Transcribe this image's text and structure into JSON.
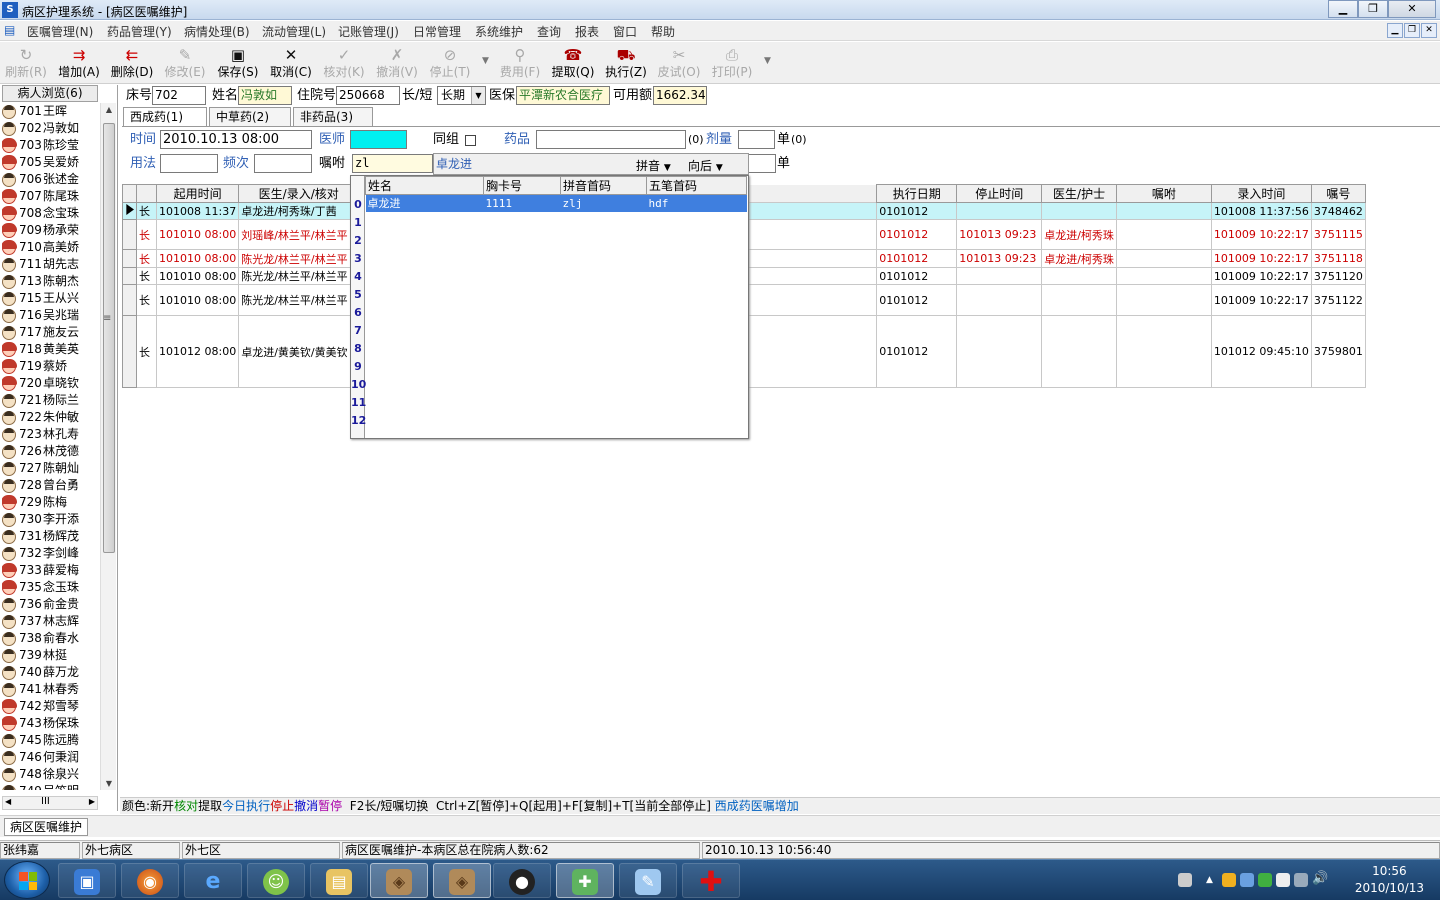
{
  "window": {
    "title": "病区护理系统 - [病区医嘱维护]",
    "app_icon": "S"
  },
  "menu": [
    "医嘱管理(N)",
    "药品管理(Y)",
    "病情处理(B)",
    "流动管理(L)",
    "记账管理(J)",
    "日常管理",
    "系统维护",
    "查询",
    "报表",
    "窗口",
    "帮助"
  ],
  "toolbar": [
    {
      "label": "刷新(R)",
      "icon": "↻",
      "enabled": false
    },
    {
      "label": "增加(A)",
      "icon": "⇉",
      "enabled": true
    },
    {
      "label": "删除(D)",
      "icon": "⇇",
      "enabled": true
    },
    {
      "label": "修改(E)",
      "icon": "✎",
      "enabled": false
    },
    {
      "label": "保存(S)",
      "icon": "▣",
      "enabled": true
    },
    {
      "label": "取消(C)",
      "icon": "✕",
      "enabled": true
    },
    {
      "label": "核对(K)",
      "icon": "✓",
      "enabled": false
    },
    {
      "label": "撤消(V)",
      "icon": "✗",
      "enabled": false
    },
    {
      "label": "停止(T)",
      "icon": "⊘",
      "enabled": false
    },
    {
      "label": "费用(F)",
      "icon": "⚲",
      "enabled": false
    },
    {
      "label": "提取(Q)",
      "icon": "☎",
      "enabled": true
    },
    {
      "label": "执行(Z)",
      "icon": "⛟",
      "enabled": true
    },
    {
      "label": "皮试(O)",
      "icon": "✂",
      "enabled": false
    },
    {
      "label": "打印(P)",
      "icon": "⎙",
      "enabled": false
    }
  ],
  "sidebar": {
    "header": "病人浏览(6)",
    "patients": [
      {
        "bed": "701",
        "name": "王晖",
        "g": "m"
      },
      {
        "bed": "702",
        "name": "冯敦如",
        "g": "m"
      },
      {
        "bed": "703",
        "name": "陈珍莹",
        "g": "f"
      },
      {
        "bed": "705",
        "name": "吴爱娇",
        "g": "f"
      },
      {
        "bed": "706",
        "name": "张述金",
        "g": "m"
      },
      {
        "bed": "707",
        "name": "陈尾珠",
        "g": "f"
      },
      {
        "bed": "708",
        "name": "念宝珠",
        "g": "f"
      },
      {
        "bed": "709",
        "name": "杨承荣",
        "g": "f"
      },
      {
        "bed": "710",
        "name": "高美娇",
        "g": "f"
      },
      {
        "bed": "711",
        "name": "胡先志",
        "g": "m"
      },
      {
        "bed": "713",
        "name": "陈朝杰",
        "g": "m"
      },
      {
        "bed": "715",
        "name": "王从兴",
        "g": "m"
      },
      {
        "bed": "716",
        "name": "吴兆瑞",
        "g": "m"
      },
      {
        "bed": "717",
        "name": "施友云",
        "g": "m"
      },
      {
        "bed": "718",
        "name": "黄美英",
        "g": "f"
      },
      {
        "bed": "719",
        "name": "蔡娇",
        "g": "f"
      },
      {
        "bed": "720",
        "name": "卓晓钦",
        "g": "f"
      },
      {
        "bed": "721",
        "name": "杨际兰",
        "g": "m"
      },
      {
        "bed": "722",
        "name": "朱仲敏",
        "g": "m"
      },
      {
        "bed": "723",
        "name": "林孔寿",
        "g": "m"
      },
      {
        "bed": "726",
        "name": "林茂德",
        "g": "m"
      },
      {
        "bed": "727",
        "name": "陈朝灿",
        "g": "m"
      },
      {
        "bed": "728",
        "name": "曾台勇",
        "g": "m"
      },
      {
        "bed": "729",
        "name": "陈梅",
        "g": "f"
      },
      {
        "bed": "730",
        "name": "李开添",
        "g": "m"
      },
      {
        "bed": "731",
        "name": "杨辉茂",
        "g": "m"
      },
      {
        "bed": "732",
        "name": "李剑峰",
        "g": "m"
      },
      {
        "bed": "733",
        "name": "薛爱梅",
        "g": "f"
      },
      {
        "bed": "735",
        "name": "念玉珠",
        "g": "f"
      },
      {
        "bed": "736",
        "name": "俞金贵",
        "g": "m"
      },
      {
        "bed": "737",
        "name": "林志辉",
        "g": "m"
      },
      {
        "bed": "738",
        "name": "俞春水",
        "g": "m"
      },
      {
        "bed": "739",
        "name": "林挺",
        "g": "m"
      },
      {
        "bed": "740",
        "name": "薛万龙",
        "g": "m"
      },
      {
        "bed": "741",
        "name": "林春秀",
        "g": "m"
      },
      {
        "bed": "742",
        "name": "郑雪琴",
        "g": "f"
      },
      {
        "bed": "743",
        "name": "杨保珠",
        "g": "f"
      },
      {
        "bed": "745",
        "name": "陈远腾",
        "g": "m"
      },
      {
        "bed": "746",
        "name": "何秉润",
        "g": "m"
      },
      {
        "bed": "748",
        "name": "徐泉兴",
        "g": "m"
      },
      {
        "bed": "749",
        "name": "吴笠明",
        "g": "m"
      }
    ],
    "hscroll_label": "III"
  },
  "patient_bar": {
    "bed_label": "床号",
    "bed": "702",
    "name_label": "姓名",
    "name": "冯敦如",
    "admission_label": "住院号",
    "admission": "250668",
    "term_label": "长/短",
    "term": "长期",
    "insurance_label": "医保",
    "insurance": "平潭新农合医疗",
    "available_label": "可用额",
    "available": "1662.34"
  },
  "tabs": [
    "西成药(1)",
    "中草药(2)",
    "非药品(3)"
  ],
  "order_form": {
    "time_label": "时间",
    "time": "2010.10.13 08:00",
    "doctor_label": "医师",
    "group_label": "同组",
    "drug_label": "药品",
    "drug": "",
    "dose_label": "剂量",
    "dose_unit": "单",
    "unit_label": "单",
    "unit_suffix": "(0)",
    "usage_label": "用法",
    "freq_label": "频次",
    "advice_label": "嘱咐",
    "search_input": "zl",
    "search_match": "卓龙进",
    "pinyin_label": "拼音",
    "direction_label": "向后"
  },
  "grid": {
    "columns": [
      "",
      "起用时间",
      "医生/录入/核对",
      "执行日期",
      "停止时间",
      "医生/护士",
      "嘱咐",
      "录入时间",
      "嘱号"
    ],
    "rows": [
      {
        "type": "长",
        "start": "101008 11:37",
        "staff": "卓龙进/柯秀珠/丁茜",
        "exec": "0101012",
        "stop": "",
        "nurse": "",
        "advice": "",
        "entry": "101008 11:37:56",
        "id": "3748462",
        "cls": "sel",
        "h": 17
      },
      {
        "type": "长",
        "start": "101010 08:00",
        "staff": "刘瑶峰/林兰平/林兰平",
        "exec": "0101012",
        "stop": "101013 09:23",
        "nurse": "卓龙进/柯秀珠",
        "advice": "",
        "entry": "101009 10:22:17",
        "id": "3751115",
        "cls": "red",
        "h": 30
      },
      {
        "type": "长",
        "start": "101010 08:00",
        "staff": "陈光龙/林兰平/林兰平",
        "exec": "0101012",
        "stop": "101013 09:23",
        "nurse": "卓龙进/柯秀珠",
        "advice": "",
        "entry": "101009 10:22:17",
        "id": "3751118",
        "cls": "red",
        "h": 18
      },
      {
        "type": "长",
        "start": "101010 08:00",
        "staff": "陈光龙/林兰平/林兰平",
        "exec": "0101012",
        "stop": "",
        "nurse": "",
        "advice": "",
        "entry": "101009 10:22:17",
        "id": "3751120",
        "cls": "",
        "h": 16
      },
      {
        "type": "长",
        "start": "101010 08:00",
        "staff": "陈光龙/林兰平/林兰平",
        "exec": "0101012",
        "stop": "",
        "nurse": "",
        "advice": "",
        "entry": "101009 10:22:17",
        "id": "3751122",
        "cls": "",
        "h": 31
      },
      {
        "type": "长",
        "start": "101012 08:00",
        "staff": "卓龙进/黄美钦/黄美钦",
        "exec": "0101012",
        "stop": "",
        "nurse": "",
        "advice": "",
        "entry": "101012 09:45:10",
        "id": "3759801",
        "cls": "",
        "h": 72
      }
    ]
  },
  "popup": {
    "columns": [
      "姓名",
      "胸卡号",
      "拼音首码",
      "五笔首码"
    ],
    "rows": [
      {
        "name": "卓龙进",
        "card": "1111",
        "pinyin": "zlj",
        "wubi": "hdf"
      }
    ],
    "row_numbers": [
      "0",
      "1",
      "2",
      "3",
      "4",
      "5",
      "6",
      "7",
      "8",
      "9",
      "10",
      "11",
      "12"
    ]
  },
  "legend": [
    {
      "t": "颜色:",
      "c": "#000000"
    },
    {
      "t": "新开",
      "c": "#000000"
    },
    {
      "t": "核对",
      "c": "#008800"
    },
    {
      "t": "提取",
      "c": "#000000"
    },
    {
      "t": "今日执行",
      "c": "#0060c0"
    },
    {
      "t": "停止",
      "c": "#cc0000"
    },
    {
      "t": "撤消",
      "c": "#0000cc"
    },
    {
      "t": "暂停",
      "c": "#aa00aa"
    },
    {
      "t": "  F2长/短嘱切换  Ctrl+Z[暂停]+Q[起用]+F[复制]+T[当前全部停止] ",
      "c": "#000000"
    },
    {
      "t": "西成药医嘱增加",
      "c": "#0060c0"
    }
  ],
  "mdi_tab": "病区医嘱维护",
  "status": [
    "张纬嘉",
    "外七病区",
    "外七区",
    "病区医嘱维护-本病区总在院病人数:62",
    "2010.10.13 10:56:40"
  ],
  "clock": {
    "time": "10:56",
    "date": "2010/10/13"
  },
  "colors": {
    "selected_row": "#c6f4f8",
    "highlight": "#3f7fdf",
    "stopped": "#cc0000",
    "label_blue": "#2f5fb4"
  }
}
